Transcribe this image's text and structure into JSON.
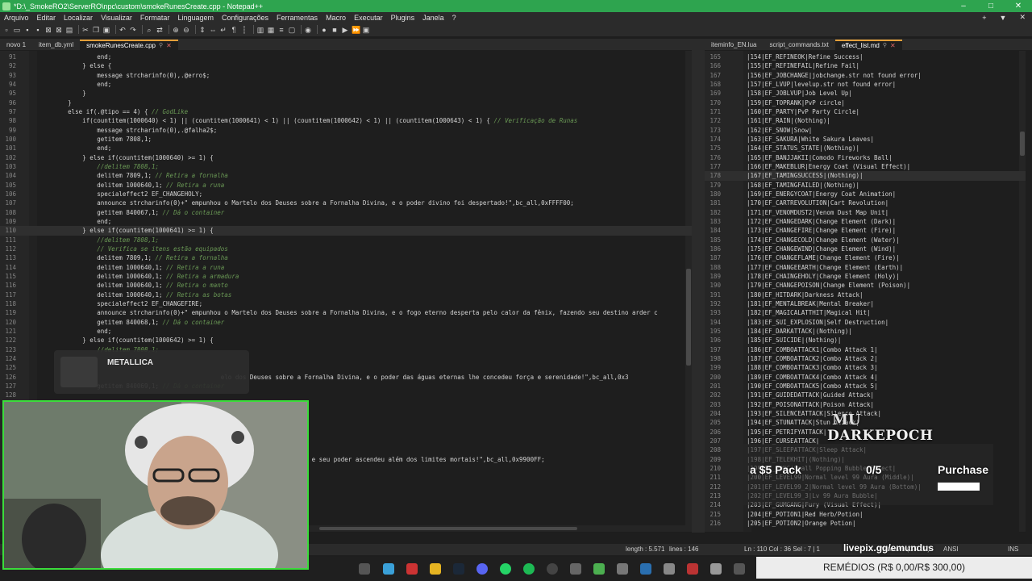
{
  "window": {
    "title": "*D:\\_SmokeRO2\\ServerRO\\npc\\custom\\smokeRunesCreate.cpp - Notepad++",
    "controls": [
      "–",
      "□",
      "✕"
    ]
  },
  "menu": [
    "Arquivo",
    "Editar",
    "Localizar",
    "Visualizar",
    "Formatar",
    "Linguagem",
    "Configurações",
    "Ferramentas",
    "Macro",
    "Executar",
    "Plugins",
    "Janela",
    "?"
  ],
  "menu_right": [
    "+",
    "▼",
    "✕"
  ],
  "left_tabs": [
    {
      "label": "novo 1",
      "active": false
    },
    {
      "label": "item_db.yml",
      "active": false
    },
    {
      "label": "smokeRunesCreate.cpp",
      "active": true
    }
  ],
  "right_tabs": [
    {
      "label": "iteminfo_EN.lua",
      "active": false
    },
    {
      "label": "script_commands.txt",
      "active": false
    },
    {
      "label": "effect_list.md",
      "active": true
    }
  ],
  "left_lines": [
    {
      "n": "91",
      "t": "                end;"
    },
    {
      "n": "92",
      "t": "            } else {"
    },
    {
      "n": "93",
      "t": "                message strcharinfo(0),.@erro$;"
    },
    {
      "n": "94",
      "t": "                end;"
    },
    {
      "n": "95",
      "t": "            }"
    },
    {
      "n": "96",
      "t": "        }"
    },
    {
      "n": "97",
      "t": "        else if(.@tipo == 4) { // GodLike"
    },
    {
      "n": "98",
      "t": "            if(countitem(1000640) < 1) || (countitem(1000641) < 1) || (countitem(1000642) < 1) || (countitem(1000643) < 1) { // Verificação de Runas"
    },
    {
      "n": "99",
      "t": "                message strcharinfo(0),.@falha2$;"
    },
    {
      "n": "100",
      "t": "                getitem 7808,1;"
    },
    {
      "n": "101",
      "t": "                end;"
    },
    {
      "n": "102",
      "t": "            } else if(countitem(1000640) >= 1) {"
    },
    {
      "n": "103",
      "t": "                //delitem 7808,1;"
    },
    {
      "n": "104",
      "t": "                delitem 7809,1; // Retira a fornalha"
    },
    {
      "n": "105",
      "t": "                delitem 1000640,1; // Retira a runa"
    },
    {
      "n": "106",
      "t": "                specialeffect2 EF_CHANGEHOLY;"
    },
    {
      "n": "107",
      "t": "                announce strcharinfo(0)+\" empunhou o Martelo dos Deuses sobre a Fornalha Divina, e o poder divino foi despertado!\",bc_all,0xFFFF00;"
    },
    {
      "n": "108",
      "t": "                getitem 840067,1; // Dá o container"
    },
    {
      "n": "109",
      "t": "                end;"
    },
    {
      "n": "110",
      "t": "            } else if(countitem(1000641) >= 1) {"
    },
    {
      "n": "111",
      "t": "                //delitem 7808,1;"
    },
    {
      "n": "112",
      "t": "                // Verifica se itens estão equipados"
    },
    {
      "n": "113",
      "t": "                delitem 7809,1; // Retira a fornalha"
    },
    {
      "n": "114",
      "t": "                delitem 1000640,1; // Retira a runa"
    },
    {
      "n": "115",
      "t": "                delitem 1000640,1; // Retira a armadura"
    },
    {
      "n": "116",
      "t": "                delitem 1000640,1; // Retira o manto"
    },
    {
      "n": "117",
      "t": "                delitem 1000640,1; // Retira as botas"
    },
    {
      "n": "118",
      "t": "                specialeffect2 EF_CHANGEFIRE;"
    },
    {
      "n": "119",
      "t": "                announce strcharinfo(0)+\" empunhou o Martelo dos Deuses sobre a Fornalha Divina, e o fogo eterno desperta pelo calor da fênix, fazendo seu destino arder c"
    },
    {
      "n": "120",
      "t": "                getitem 840068,1; // Dá o container"
    },
    {
      "n": "121",
      "t": "                end;"
    },
    {
      "n": "122",
      "t": "            } else if(countitem(1000642) >= 1) {"
    },
    {
      "n": "123",
      "t": "                //delitem 7808,1;"
    },
    {
      "n": "124",
      "t": ""
    },
    {
      "n": "125",
      "t": ""
    },
    {
      "n": "126",
      "t": "                                                  elo dos Deuses sobre a Fornalha Divina, e o poder das águas eternas lhe concedeu força e serenidade!\",bc_all,0x3"
    },
    {
      "n": "127",
      "t": "                getitem 840069,1; // Dá o container"
    },
    {
      "n": "128",
      "t": ""
    },
    {
      "n": "129",
      "t": ""
    },
    {
      "n": "130",
      "t": ""
    },
    {
      "n": "131",
      "t": ""
    },
    {
      "n": "132",
      "t": ""
    },
    {
      "n": "133",
      "t": ""
    },
    {
      "n": "134",
      "t": ""
    },
    {
      "n": "135",
      "t": "                                                  sobre a Fornalha Divina, e seu poder ascendeu além dos limites mortais!\",bc_all,0x9900FF;"
    }
  ],
  "right_lines": [
    {
      "n": "165",
      "t": "|154|EF_REFINEOK|Refine Success|"
    },
    {
      "n": "166",
      "t": "|155|EF_REFINEFAIL|Refine Fail|"
    },
    {
      "n": "167",
      "t": "|156|EF_JOBCHANGE|jobchange.str not found error|"
    },
    {
      "n": "168",
      "t": "|157|EF_LVUP|levelup.str not found error|"
    },
    {
      "n": "169",
      "t": "|158|EF_JOBLVUP|Job Level Up|"
    },
    {
      "n": "170",
      "t": "|159|EF_TOPRANK|PvP circle|"
    },
    {
      "n": "171",
      "t": "|160|EF_PARTY|PvP Party Circle|"
    },
    {
      "n": "172",
      "t": "|161|EF_RAIN|(Nothing)|"
    },
    {
      "n": "173",
      "t": "|162|EF_SNOW|Snow|"
    },
    {
      "n": "174",
      "t": "|163|EF_SAKURA|White Sakura Leaves|"
    },
    {
      "n": "175",
      "t": "|164|EF_STATUS_STATE|(Nothing)|"
    },
    {
      "n": "176",
      "t": "|165|EF_BANJJAKII|Comodo Fireworks Ball|"
    },
    {
      "n": "177",
      "t": "|166|EF_MAKEBLUR|Energy Coat (Visual Effect)|"
    },
    {
      "n": "178",
      "t": "|167|EF_TAMINGSUCCESS|(Nothing)|"
    },
    {
      "n": "179",
      "t": "|168|EF_TAMINGFAILED|(Nothing)|"
    },
    {
      "n": "180",
      "t": "|169|EF_ENERGYCOAT|Energy Coat Animation|"
    },
    {
      "n": "181",
      "t": "|170|EF_CARTREVOLUTION|Cart Revolution|"
    },
    {
      "n": "182",
      "t": "|171|EF_VENOMDUST2|Venom Dust Map Unit|"
    },
    {
      "n": "183",
      "t": "|172|EF_CHANGEDARK|Change Element (Dark)|"
    },
    {
      "n": "184",
      "t": "|173|EF_CHANGEFIRE|Change Element (Fire)|"
    },
    {
      "n": "185",
      "t": "|174|EF_CHANGECOLD|Change Element (Water)|"
    },
    {
      "n": "186",
      "t": "|175|EF_CHANGEWIND|Change Element (Wind)|"
    },
    {
      "n": "187",
      "t": "|176|EF_CHANGEFLAME|Change Element (Fire)|"
    },
    {
      "n": "188",
      "t": "|177|EF_CHANGEEARTH|Change Element (Earth)|"
    },
    {
      "n": "189",
      "t": "|178|EF_CHAINGEHOLY|Change Element (Holy)|"
    },
    {
      "n": "190",
      "t": "|179|EF_CHANGEPOISON|Change Element (Poison)|"
    },
    {
      "n": "191",
      "t": "|180|EF_HITDARK|Darkness Attack|"
    },
    {
      "n": "192",
      "t": "|181|EF_MENTALBREAK|Mental Breaker|"
    },
    {
      "n": "193",
      "t": "|182|EF_MAGICALATTHIT|Magical Hit|"
    },
    {
      "n": "194",
      "t": "|183|EF_SUI_EXPLOSION|Self Destruction|"
    },
    {
      "n": "195",
      "t": "|184|EF_DARKATTACK|(Nothing)|"
    },
    {
      "n": "196",
      "t": "|185|EF_SUICIDE|(Nothing)|"
    },
    {
      "n": "197",
      "t": "|186|EF_COMBOATTACK1|Combo Attack 1|"
    },
    {
      "n": "198",
      "t": "|187|EF_COMBOATTACK2|Combo Attack 2|"
    },
    {
      "n": "199",
      "t": "|188|EF_COMBOATTACK3|Combo Attack 3|"
    },
    {
      "n": "200",
      "t": "|189|EF_COMBOATTACK4|Combo Attack 4|"
    },
    {
      "n": "201",
      "t": "|190|EF_COMBOATTACK5|Combo Attack 5|"
    },
    {
      "n": "202",
      "t": "|191|EF_GUIDEDATTACK|Guided Attack|"
    },
    {
      "n": "203",
      "t": "|192|EF_POISONATTACK|Poison Attack|"
    },
    {
      "n": "204",
      "t": "|193|EF_SILENCEATTACK|Silence Attack|"
    },
    {
      "n": "205",
      "t": "|194|EF_STUNATTACK|Stun Attack|"
    },
    {
      "n": "206",
      "t": "|195|EF_PETRIFYATTACK|"
    },
    {
      "n": "207",
      "t": "|196|EF_CURSEATTACK|"
    },
    {
      "n": "208",
      "t": "|197|EF_SLEEPATTACK|Sleep Attack|"
    },
    {
      "n": "209",
      "t": "|198|EF_TELEKHIT|(Nothing)|"
    },
    {
      "n": "210",
      "t": "|199|EF_PONG|Small Popping Bubble Effect|"
    },
    {
      "n": "211",
      "t": "|200|EF_LEVEL99|Normal level 99 Aura (Middle)|"
    },
    {
      "n": "212",
      "t": "|201|EF_LEVEL99_2|Normal level 99 Aura (Bottom)|"
    },
    {
      "n": "213",
      "t": "|202|EF_LEVEL99_3|Lv 99 Aura Bubble|"
    },
    {
      "n": "214",
      "t": "|203|EF_GUMGANG|Fury (Visual Effect)|"
    },
    {
      "n": "215",
      "t": "|204|EF_POTION1|Red Herb/Potion|"
    },
    {
      "n": "216",
      "t": "|205|EF_POTION2|Orange Potion|"
    }
  ],
  "status": {
    "length": "length : 5.571",
    "lines": "lines : 146",
    "position": "Ln : 110   Col : 36   Sel : 7 | 1",
    "eol": "Windows (CR LF)",
    "encoding": "ANSI",
    "mode": "INS"
  },
  "overlay": {
    "music_title": "METALLICA",
    "brand_top": "MU",
    "brand_bottom": "DARKEPOCH",
    "pack": "a $5 Pack",
    "count": "0/5",
    "purchase": "Purchase",
    "livepix": "livepix.gg/emundus",
    "donation": "REMÉDIOS (R$ 0,00/R$ 300,00)"
  },
  "colors": {
    "title_bar": "#2ea44f",
    "editor_bg": "#1e1e1e",
    "comment": "#6a9955",
    "webcam_border": "#3bdc3b"
  }
}
